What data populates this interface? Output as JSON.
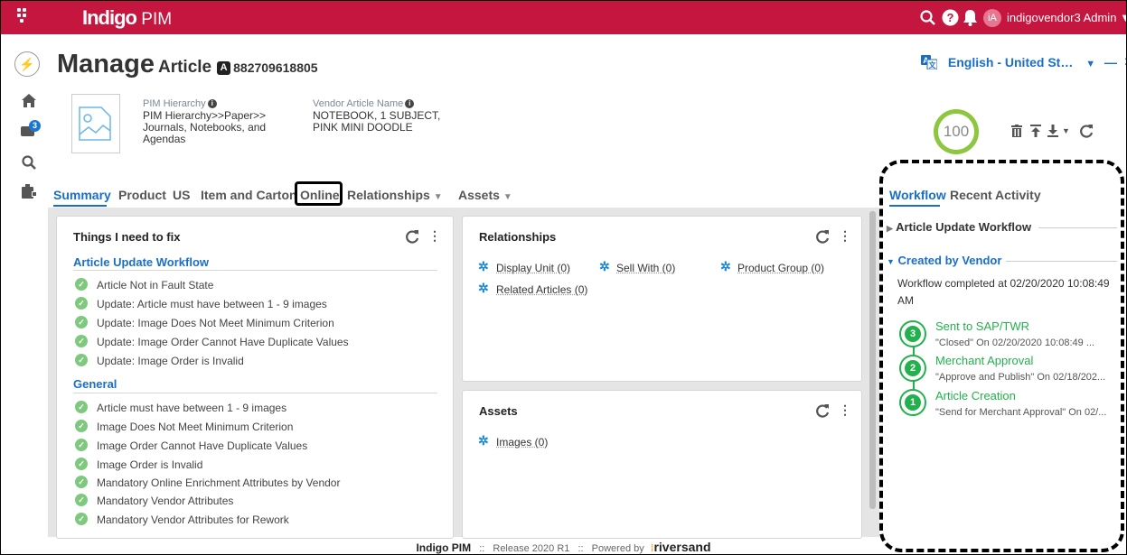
{
  "app": {
    "brand": "Indigo",
    "brand_suffix": "PIM",
    "user_initials": "iA",
    "user_name": "indigovendor3 Admin",
    "accent": "#c4163f"
  },
  "header": {
    "manage": "Manage",
    "entity": "Article",
    "entity_badge": "A",
    "article_id": "882709618805",
    "language": "English - United St…"
  },
  "sidebar": {
    "notification_count": "3"
  },
  "attributes": [
    {
      "label": "PIM Hierarchy",
      "value_lines": [
        "PIM Hierarchy>>Paper>>",
        "Journals, Notebooks, and",
        "Agendas"
      ]
    },
    {
      "label": "Vendor Article Name",
      "value_lines": [
        "NOTEBOOK, 1 SUBJECT,",
        "PINK MINI DOODLE"
      ]
    }
  ],
  "completeness_score": "100",
  "tabs": [
    "Summary",
    "Product",
    "US",
    "Item and Carton",
    "Online",
    "Relationships",
    "Assets"
  ],
  "fix_panel": {
    "title": "Things I need to fix",
    "section1": "Article Update Workflow",
    "items1": [
      "Article Not in Fault State",
      "Update: Article must have between 1 - 9 images",
      "Update: Image Does Not Meet Minimum Criterion",
      "Update: Image Order Cannot Have Duplicate Values",
      "Update: Image Order is Invalid"
    ],
    "section2": "General",
    "items2": [
      "Article must have between 1 - 9 images",
      "Image Does Not Meet Minimum Criterion",
      "Image Order Cannot Have Duplicate Values",
      "Image Order is Invalid",
      "Mandatory Online Enrichment Attributes by Vendor",
      "Mandatory Vendor Attributes",
      "Mandatory Vendor Attributes for Rework"
    ]
  },
  "relationships_panel": {
    "title": "Relationships",
    "items": [
      "Display Unit (0)",
      "Sell With (0)",
      "Product Group (0)",
      "Related Articles (0)"
    ]
  },
  "assets_panel": {
    "title": "Assets",
    "items": [
      "Images (0)"
    ]
  },
  "right_panel": {
    "tabs": [
      "Workflow",
      "Recent Activity"
    ],
    "workflow1": "Article Update Workflow",
    "workflow2": "Created by Vendor",
    "completed_lines": [
      "Workflow completed at 02/20/2020 10:08:49",
      "AM"
    ],
    "steps": [
      {
        "num": "3",
        "name": "Sent to SAP/TWR",
        "detail": "\"Closed\" On 02/20/2020 10:08:49 ..."
      },
      {
        "num": "2",
        "name": "Merchant Approval",
        "detail": "\"Approve and Publish\" On 02/18/202..."
      },
      {
        "num": "1",
        "name": "Article Creation",
        "detail": "\"Send for Merchant Approval\" On 02/..."
      }
    ]
  },
  "footer": {
    "product": "Indigo PIM",
    "sep": "::",
    "release": "Release 2020 R1",
    "powered": "Powered by",
    "vendor": "riversand"
  }
}
